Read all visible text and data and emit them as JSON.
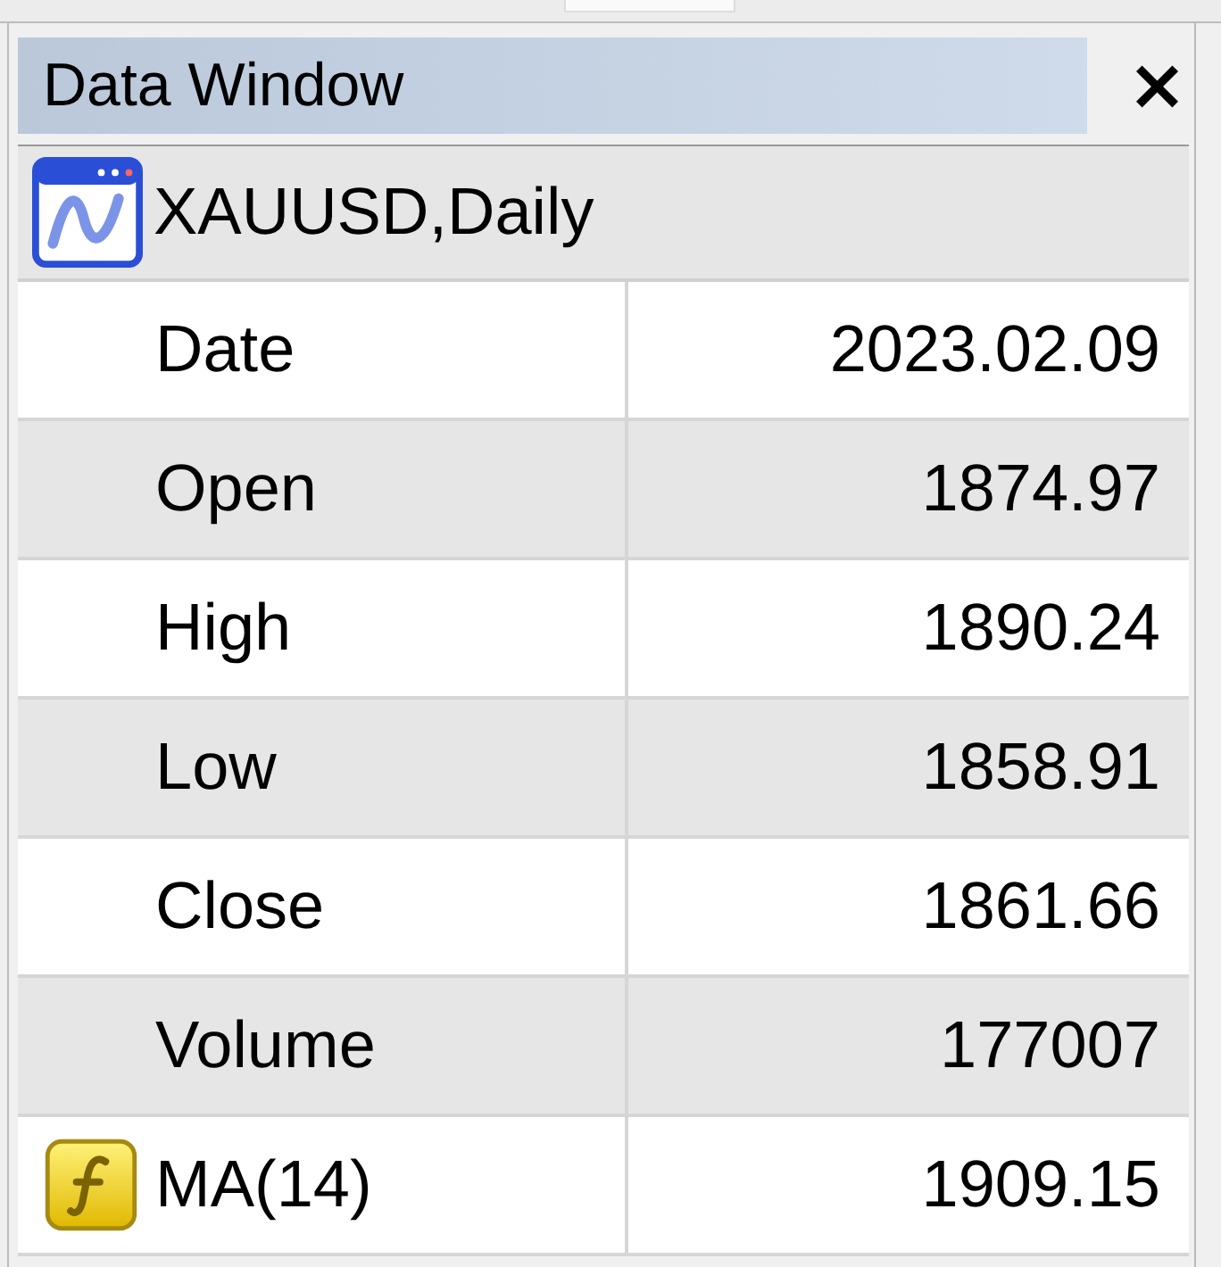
{
  "window": {
    "title": "Data Window",
    "close": "×"
  },
  "symbol": "XAUUSD,Daily",
  "rows": [
    {
      "kind": "field",
      "label": "Date",
      "value": "2023.02.09"
    },
    {
      "kind": "field",
      "label": "Open",
      "value": "1874.97"
    },
    {
      "kind": "field",
      "label": "High",
      "value": "1890.24"
    },
    {
      "kind": "field",
      "label": "Low",
      "value": "1858.91"
    },
    {
      "kind": "field",
      "label": "Close",
      "value": "1861.66"
    },
    {
      "kind": "field",
      "label": "Volume",
      "value": "177007"
    },
    {
      "kind": "indicator",
      "label": "MA(14)",
      "value": "1909.15"
    }
  ]
}
